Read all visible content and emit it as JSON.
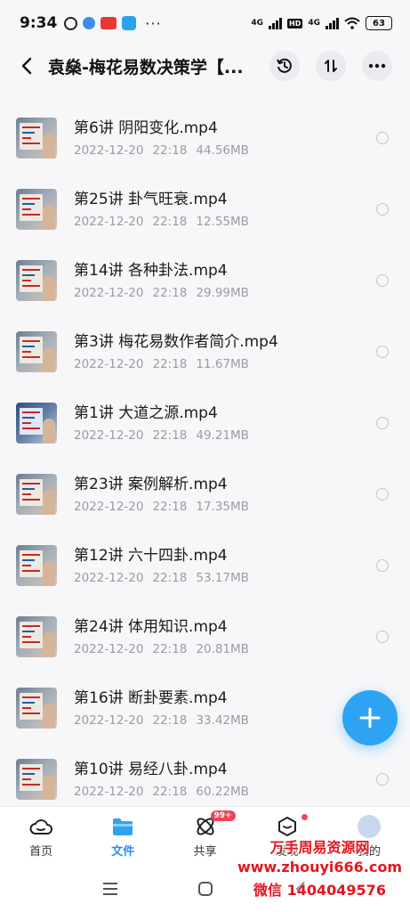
{
  "status_bar": {
    "time": "9:34",
    "net1": "4G",
    "hd": "HD",
    "net2": "4G",
    "battery": "63",
    "more": "···"
  },
  "header": {
    "title": "袁燊-梅花易数决策学【...",
    "icons": [
      "back-arrow-icon",
      "history-icon",
      "sort-icon",
      "more-icon"
    ]
  },
  "files": [
    {
      "name": "第6讲 阴阳变化.mp4",
      "date": "2022-12-20",
      "time": "22:18",
      "size": "44.56MB"
    },
    {
      "name": "第25讲 卦气旺衰.mp4",
      "date": "2022-12-20",
      "time": "22:18",
      "size": "12.55MB"
    },
    {
      "name": "第14讲 各种卦法.mp4",
      "date": "2022-12-20",
      "time": "22:18",
      "size": "29.99MB"
    },
    {
      "name": "第3讲 梅花易数作者简介.mp4",
      "date": "2022-12-20",
      "time": "22:18",
      "size": "11.67MB"
    },
    {
      "name": "第1讲 大道之源.mp4",
      "date": "2022-12-20",
      "time": "22:18",
      "size": "49.21MB"
    },
    {
      "name": "第23讲 案例解析.mp4",
      "date": "2022-12-20",
      "time": "22:18",
      "size": "17.35MB"
    },
    {
      "name": "第12讲 六十四卦.mp4",
      "date": "2022-12-20",
      "time": "22:18",
      "size": "53.17MB"
    },
    {
      "name": "第24讲 体用知识.mp4",
      "date": "2022-12-20",
      "time": "22:18",
      "size": "20.81MB"
    },
    {
      "name": "第16讲 断卦要素.mp4",
      "date": "2022-12-20",
      "time": "22:18",
      "size": "33.42MB"
    },
    {
      "name": "第10讲 易经八卦.mp4",
      "date": "2022-12-20",
      "time": "22:18",
      "size": "60.22MB"
    }
  ],
  "bottom_nav": {
    "items": [
      {
        "label": "首页",
        "icon": "cloud-icon"
      },
      {
        "label": "文件",
        "icon": "folder-icon"
      },
      {
        "label": "共享",
        "icon": "share-atom-icon",
        "badge": "99+"
      },
      {
        "label": "发现",
        "icon": "discover-icon"
      },
      {
        "label": "我的",
        "icon": "avatar"
      }
    ],
    "active_index": 1
  },
  "watermark": {
    "line1": "万手周易资源网",
    "line2": "www.zhouyi666.com",
    "line3": "微信 1404049576"
  },
  "colors": {
    "accent": "#2fa3f3",
    "active_tab": "#2b8ee8",
    "badge": "#f0445a",
    "watermark": "#e4161f"
  }
}
